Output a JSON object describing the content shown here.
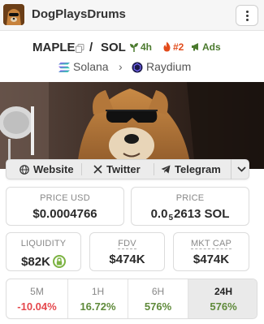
{
  "header": {
    "title": "DogPlaysDrums",
    "avatar_icon": "dog-avatar-icon",
    "menu_icon": "vertical-ellipsis-icon"
  },
  "pair": {
    "base": "MAPLE",
    "separator": "/",
    "quote": "SOL",
    "copy_icon": "copy-icon",
    "age_badge": "4h",
    "rank_badge": "#2",
    "ads_badge": "Ads",
    "chain": "Solana",
    "dex": "Raydium"
  },
  "links": {
    "website": "Website",
    "twitter": "Twitter",
    "telegram": "Telegram",
    "more_icon": "chevron-down-icon"
  },
  "stats": {
    "price_usd_label": "PRICE USD",
    "price_usd_value": "$0.0004766",
    "price_label": "PRICE",
    "price_prefix": "0.0",
    "price_zero_count": "5",
    "price_digits": "2613 SOL",
    "liquidity_label": "LIQUIDITY",
    "liquidity_value": "$82K",
    "fdv_label": "FDV",
    "fdv_value": "$474K",
    "mktcap_label": "MKT CAP",
    "mktcap_value": "$474K"
  },
  "timeframes": [
    {
      "label": "5M",
      "value": "-10.04%"
    },
    {
      "label": "1H",
      "value": "16.72%"
    },
    {
      "label": "6H",
      "value": "576%"
    },
    {
      "label": "24H",
      "value": "576%"
    }
  ],
  "colors": {
    "negative": "#e5484d",
    "positive": "#5f8a3a",
    "rank": "#e24b1b",
    "badge_green": "#4b7a2e"
  }
}
